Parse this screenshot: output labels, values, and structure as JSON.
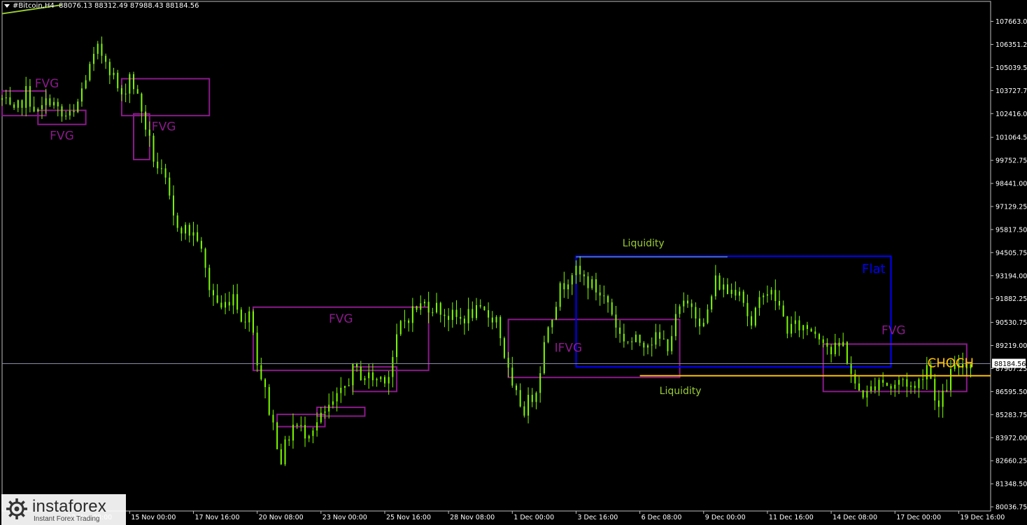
{
  "header": {
    "symbol": "#Bitcoin,H4",
    "ohlc": "88076.13 88312.49 87988.43 88184.56"
  },
  "watermark": {
    "name": "instaforex",
    "tagline": "Instant Forex Trading"
  },
  "colors": {
    "background": "#000000",
    "candles": "#7CFC00",
    "fvg_box": "#8B1A8B",
    "flat_box": "#0000FF",
    "liquidity_text": "#9ACD32",
    "choch_line": "#FFC000",
    "bid_line": "#8A8AA8"
  },
  "chart_data": {
    "type": "candlestick",
    "symbol": "#Bitcoin",
    "timeframe": "H4",
    "y_ticks": [
      107663.0,
      106351.25,
      105039.5,
      103727.75,
      102416.0,
      101064.5,
      99752.75,
      98441.0,
      97129.25,
      95817.5,
      94505.75,
      93194.0,
      91882.25,
      90530.75,
      89219.0,
      87907.25,
      86595.5,
      85283.75,
      83972.0,
      82660.25,
      81348.5,
      80036.75
    ],
    "ylim": [
      79800,
      108800
    ],
    "current_price_label": "88184.56",
    "x_ticks": [
      "12 Nov 08:00",
      "15 Nov 00:00",
      "17 Nov 16:00",
      "20 Nov 08:00",
      "23 Nov 00:00",
      "25 Nov 16:00",
      "28 Nov 08:00",
      "1 Dec 00:00",
      "3 Dec 16:00",
      "6 Dec 08:00",
      "9 Dec 00:00",
      "11 Dec 16:00",
      "14 Dec 08:00",
      "17 Dec 00:00",
      "19 Dec 16:00"
    ],
    "x_range": [
      "9 Nov 16:00",
      "21 Dec 00:00"
    ],
    "price_path": [
      {
        "t": "9 Nov 16:00",
        "p": 103200
      },
      {
        "t": "10 Nov 04:00",
        "p": 102300
      },
      {
        "t": "10 Nov 16:00",
        "p": 103600
      },
      {
        "t": "11 Nov 04:00",
        "p": 102400
      },
      {
        "t": "11 Nov 16:00",
        "p": 103300
      },
      {
        "t": "12 Nov 04:00",
        "p": 102200
      },
      {
        "t": "12 Nov 16:00",
        "p": 102300
      },
      {
        "t": "13 Nov 04:00",
        "p": 104500
      },
      {
        "t": "13 Nov 16:00",
        "p": 106000
      },
      {
        "t": "14 Nov 00:00",
        "p": 105600
      },
      {
        "t": "14 Nov 08:00",
        "p": 104500
      },
      {
        "t": "14 Nov 16:00",
        "p": 103200
      },
      {
        "t": "15 Nov 00:00",
        "p": 104700
      },
      {
        "t": "15 Nov 12:00",
        "p": 102600
      },
      {
        "t": "16 Nov 00:00",
        "p": 99900
      },
      {
        "t": "16 Nov 12:00",
        "p": 98400
      },
      {
        "t": "16 Nov 20:00",
        "p": 96400
      },
      {
        "t": "17 Nov 08:00",
        "p": 95800
      },
      {
        "t": "17 Nov 20:00",
        "p": 95400
      },
      {
        "t": "18 Nov 08:00",
        "p": 92500
      },
      {
        "t": "18 Nov 20:00",
        "p": 91300
      },
      {
        "t": "19 Nov 08:00",
        "p": 92200
      },
      {
        "t": "19 Nov 20:00",
        "p": 90300
      },
      {
        "t": "20 Nov 00:00",
        "p": 91600
      },
      {
        "t": "20 Nov 08:00",
        "p": 88400
      },
      {
        "t": "20 Nov 20:00",
        "p": 85600
      },
      {
        "t": "21 Nov 08:00",
        "p": 82800
      },
      {
        "t": "21 Nov 20:00",
        "p": 84700
      },
      {
        "t": "22 Nov 08:00",
        "p": 84300
      },
      {
        "t": "22 Nov 20:00",
        "p": 84800
      },
      {
        "t": "23 Nov 08:00",
        "p": 85600
      },
      {
        "t": "23 Nov 20:00",
        "p": 86400
      },
      {
        "t": "24 Nov 08:00",
        "p": 87800
      },
      {
        "t": "24 Nov 20:00",
        "p": 87500
      },
      {
        "t": "25 Nov 08:00",
        "p": 87300
      },
      {
        "t": "25 Nov 20:00",
        "p": 87600
      },
      {
        "t": "26 Nov 08:00",
        "p": 90400
      },
      {
        "t": "26 Nov 20:00",
        "p": 91200
      },
      {
        "t": "27 Nov 08:00",
        "p": 91600
      },
      {
        "t": "27 Nov 20:00",
        "p": 91400
      },
      {
        "t": "28 Nov 08:00",
        "p": 90900
      },
      {
        "t": "28 Nov 20:00",
        "p": 90700
      },
      {
        "t": "29 Nov 08:00",
        "p": 91100
      },
      {
        "t": "29 Nov 20:00",
        "p": 91000
      },
      {
        "t": "30 Nov 08:00",
        "p": 90800
      },
      {
        "t": "1 Dec 00:00",
        "p": 86600
      },
      {
        "t": "1 Dec 12:00",
        "p": 85600
      },
      {
        "t": "2 Dec 00:00",
        "p": 86800
      },
      {
        "t": "2 Dec 12:00",
        "p": 90500
      },
      {
        "t": "3 Dec 00:00",
        "p": 92400
      },
      {
        "t": "3 Dec 12:00",
        "p": 93500
      },
      {
        "t": "4 Dec 00:00",
        "p": 93000
      },
      {
        "t": "4 Dec 12:00",
        "p": 92400
      },
      {
        "t": "5 Dec 00:00",
        "p": 91700
      },
      {
        "t": "5 Dec 12:00",
        "p": 89800
      },
      {
        "t": "6 Dec 00:00",
        "p": 89400
      },
      {
        "t": "6 Dec 12:00",
        "p": 89500
      },
      {
        "t": "7 Dec 00:00",
        "p": 89600
      },
      {
        "t": "7 Dec 12:00",
        "p": 89300
      },
      {
        "t": "8 Dec 00:00",
        "p": 91300
      },
      {
        "t": "8 Dec 12:00",
        "p": 91600
      },
      {
        "t": "9 Dec 00:00",
        "p": 90300
      },
      {
        "t": "9 Dec 12:00",
        "p": 92900
      },
      {
        "t": "10 Dec 00:00",
        "p": 92300
      },
      {
        "t": "10 Dec 12:00",
        "p": 92600
      },
      {
        "t": "11 Dec 00:00",
        "p": 90200
      },
      {
        "t": "11 Dec 12:00",
        "p": 92500
      },
      {
        "t": "12 Dec 00:00",
        "p": 91900
      },
      {
        "t": "12 Dec 12:00",
        "p": 90200
      },
      {
        "t": "13 Dec 00:00",
        "p": 90300
      },
      {
        "t": "13 Dec 12:00",
        "p": 90200
      },
      {
        "t": "14 Dec 00:00",
        "p": 89700
      },
      {
        "t": "14 Dec 08:00",
        "p": 88800
      },
      {
        "t": "14 Dec 20:00",
        "p": 89300
      },
      {
        "t": "15 Dec 08:00",
        "p": 86800
      },
      {
        "t": "15 Dec 20:00",
        "p": 86400
      },
      {
        "t": "16 Dec 08:00",
        "p": 87400
      },
      {
        "t": "16 Dec 20:00",
        "p": 86800
      },
      {
        "t": "17 Dec 08:00",
        "p": 87300
      },
      {
        "t": "17 Dec 20:00",
        "p": 86700
      },
      {
        "t": "18 Dec 08:00",
        "p": 88200
      },
      {
        "t": "18 Dec 20:00",
        "p": 85600
      },
      {
        "t": "19 Dec 08:00",
        "p": 87600
      },
      {
        "t": "19 Dec 20:00",
        "p": 88300
      },
      {
        "t": "20 Dec 04:00",
        "p": 88184
      }
    ],
    "zones": [
      {
        "label": "FVG",
        "t1": "9 Nov 16:00",
        "t2": "11 Nov 12:00",
        "p_top": 103700,
        "p_bot": 102300,
        "label_pos": "inside-top"
      },
      {
        "label": "FVG",
        "t1": "11 Nov 04:00",
        "t2": "13 Nov 04:00",
        "p_top": 102600,
        "p_bot": 101800,
        "label_pos": "below"
      },
      {
        "label": "",
        "t1": "14 Nov 16:00",
        "t2": "18 Nov 08:00",
        "p_top": 104400,
        "p_bot": 102300,
        "label_pos": "none"
      },
      {
        "label": "FVG",
        "t1": "15 Nov 04:00",
        "t2": "15 Nov 20:00",
        "p_top": 102400,
        "p_bot": 99800,
        "label_pos": "right"
      },
      {
        "label": "FVG",
        "t1": "20 Nov 04:00",
        "t2": "27 Nov 12:00",
        "p_top": 91400,
        "p_bot": 87800,
        "label_pos": "inside-top"
      },
      {
        "label": "",
        "t1": "24 Nov 08:00",
        "t2": "26 Nov 04:00",
        "p_top": 88000,
        "p_bot": 86600,
        "label_pos": "none"
      },
      {
        "label": "",
        "t1": "22 Nov 20:00",
        "t2": "24 Nov 20:00",
        "p_top": 85700,
        "p_bot": 85200,
        "label_pos": "none"
      },
      {
        "label": "",
        "t1": "21 Nov 04:00",
        "t2": "23 Nov 04:00",
        "p_top": 85300,
        "p_bot": 84600,
        "label_pos": "none"
      },
      {
        "label": "IFVG",
        "t1": "30 Nov 20:00",
        "t2": "8 Dec 00:00",
        "p_top": 90700,
        "p_bot": 87400,
        "label_pos": "inside-left"
      }
    ],
    "flat_box": {
      "label": "Flat",
      "t1": "3 Dec 16:00",
      "t2": "16 Dec 20:00",
      "p_top": 94300,
      "p_bot": 88000
    },
    "fvg_right": {
      "label": "FVG",
      "t1": "14 Dec 00:00",
      "t2": "20 Dec 00:00",
      "p_top": 89300,
      "p_bot": 86600
    },
    "liquidity_top": {
      "label": "Liquidity",
      "t1": "3 Dec 16:00",
      "t2": "10 Dec 00:00",
      "p": 94300
    },
    "liquidity_bottom": {
      "label": "Liquidity",
      "t1": "6 Dec 08:00",
      "p": 87400
    },
    "choch": {
      "label": "CHOCH",
      "t_start": "6 Dec 08:00",
      "p": 87500
    },
    "trend_stub": {
      "t1": "9 Nov 16:00",
      "t2": "12 Nov 04:00",
      "p1": 108100,
      "p2": 108600
    }
  }
}
